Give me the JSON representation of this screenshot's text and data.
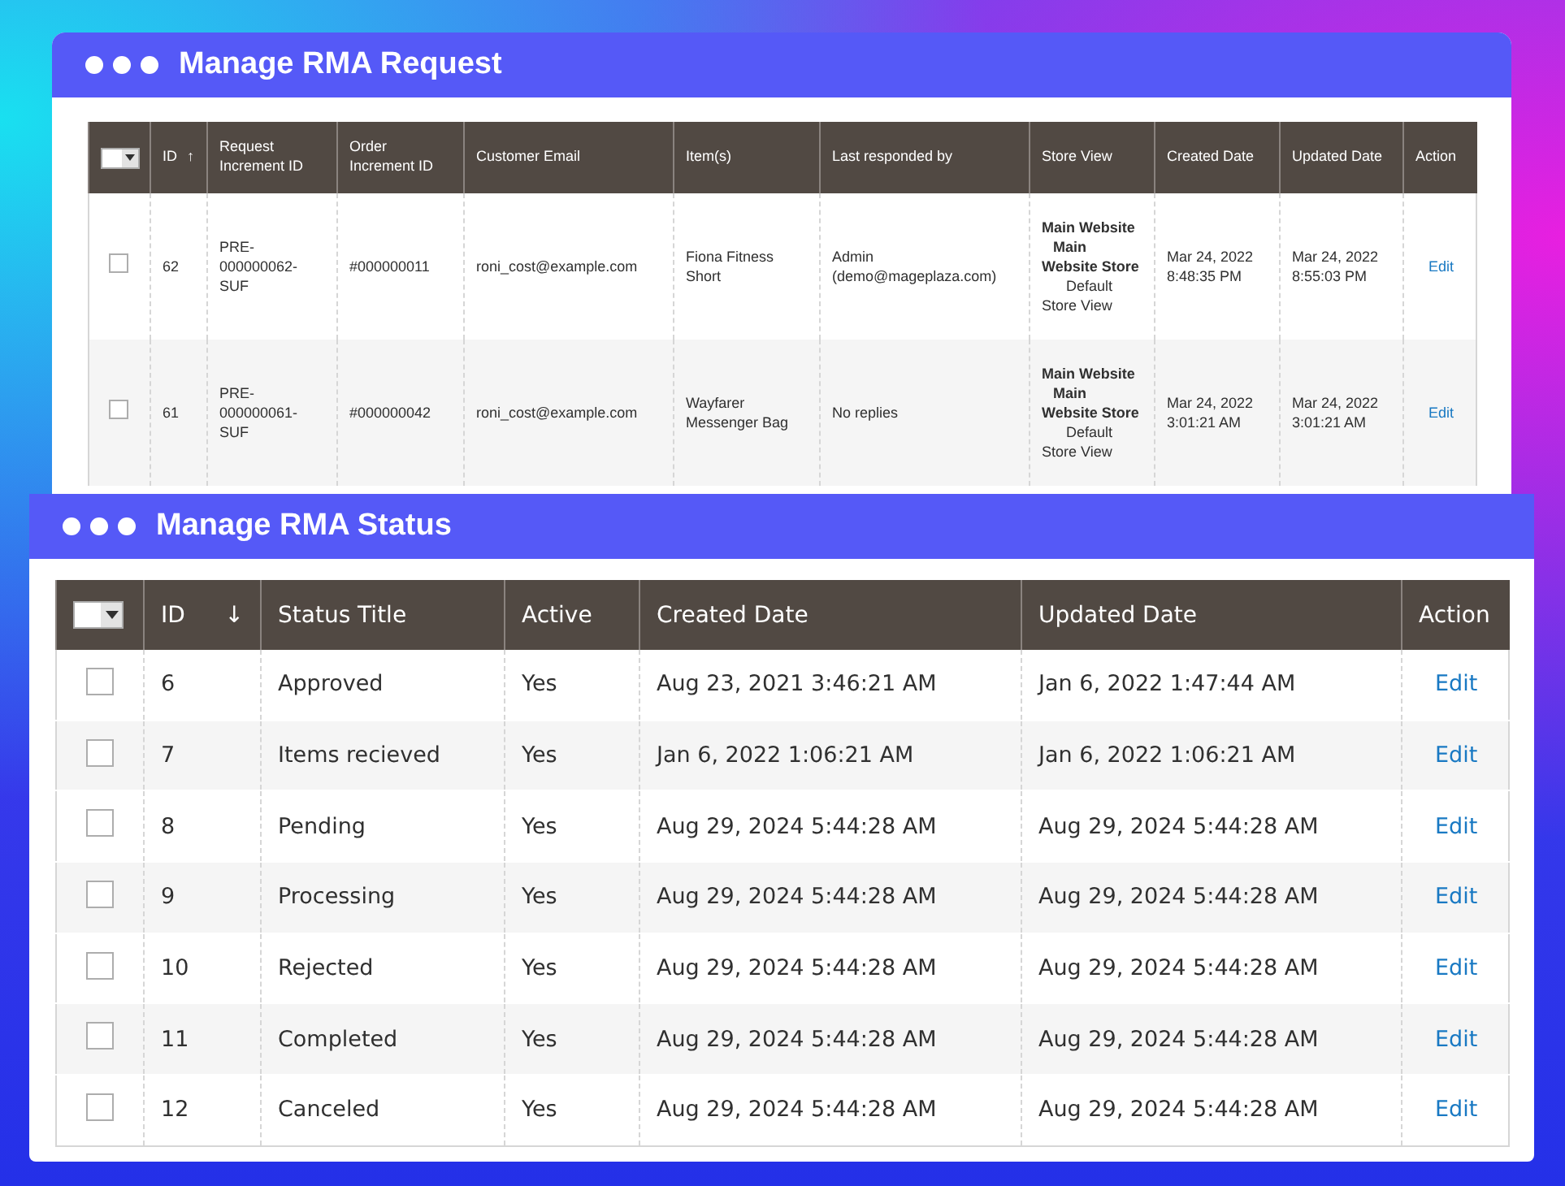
{
  "rma_request": {
    "title": "Manage RMA Request",
    "columns": [
      {
        "label": "ID",
        "sort": "↑"
      },
      {
        "label": "Request Increment ID"
      },
      {
        "label": "Order Increment ID"
      },
      {
        "label": "Customer Email"
      },
      {
        "label": "Item(s)"
      },
      {
        "label": "Last responded by"
      },
      {
        "label": "Store View"
      },
      {
        "label": "Created Date"
      },
      {
        "label": "Updated Date"
      },
      {
        "label": "Action"
      }
    ],
    "rows": [
      {
        "selected": false,
        "id": "62",
        "request_id": "PRE-000000062-SUF",
        "order_id": "#000000011",
        "email": "roni_cost@example.com",
        "items": "Fiona Fitness Short",
        "last_responded": "Admin (demo@mageplaza.com)",
        "store_view": {
          "website": "Main Website",
          "store": "Main Website Store",
          "view": "Default Store View"
        },
        "created": "Mar 24, 2022 8:48:35 PM",
        "updated": "Mar 24, 2022 8:55:03 PM",
        "action": "Edit"
      },
      {
        "selected": false,
        "id": "61",
        "request_id": "PRE-000000061-SUF",
        "order_id": "#000000042",
        "email": "roni_cost@example.com",
        "items": "Wayfarer Messenger Bag",
        "last_responded": "No replies",
        "store_view": {
          "website": "Main Website",
          "store": "Main Website Store",
          "view": "Default Store View"
        },
        "created": "Mar 24, 2022 3:01:21 AM",
        "updated": "Mar 24, 2022 3:01:21 AM",
        "action": "Edit"
      }
    ]
  },
  "rma_status": {
    "title": "Manage RMA Status",
    "columns": [
      {
        "label": "ID",
        "sort": "↓"
      },
      {
        "label": "Status Title"
      },
      {
        "label": "Active"
      },
      {
        "label": "Created Date"
      },
      {
        "label": "Updated Date"
      },
      {
        "label": "Action"
      }
    ],
    "rows": [
      {
        "selected": false,
        "id": "6",
        "title": "Approved",
        "active": "Yes",
        "created": "Aug 23, 2021 3:46:21 AM",
        "updated": "Jan 6, 2022 1:47:44 AM",
        "action": "Edit"
      },
      {
        "selected": false,
        "id": "7",
        "title": "Items recieved",
        "active": "Yes",
        "created": "Jan 6, 2022 1:06:21 AM",
        "updated": "Jan 6, 2022 1:06:21 AM",
        "action": "Edit"
      },
      {
        "selected": false,
        "id": "8",
        "title": "Pending",
        "active": "Yes",
        "created": "Aug 29, 2024 5:44:28 AM",
        "updated": "Aug 29, 2024 5:44:28 AM",
        "action": "Edit"
      },
      {
        "selected": false,
        "id": "9",
        "title": "Processing",
        "active": "Yes",
        "created": "Aug 29, 2024 5:44:28 AM",
        "updated": "Aug 29, 2024 5:44:28 AM",
        "action": "Edit"
      },
      {
        "selected": false,
        "id": "10",
        "title": "Rejected",
        "active": "Yes",
        "created": "Aug 29, 2024 5:44:28 AM",
        "updated": "Aug 29, 2024 5:44:28 AM",
        "action": "Edit"
      },
      {
        "selected": false,
        "id": "11",
        "title": "Completed",
        "active": "Yes",
        "created": "Aug 29, 2024 5:44:28 AM",
        "updated": "Aug 29, 2024 5:44:28 AM",
        "action": "Edit"
      },
      {
        "selected": false,
        "id": "12",
        "title": "Canceled",
        "active": "Yes",
        "created": "Aug 29, 2024 5:44:28 AM",
        "updated": "Aug 29, 2024 5:44:28 AM",
        "action": "Edit"
      }
    ]
  }
}
